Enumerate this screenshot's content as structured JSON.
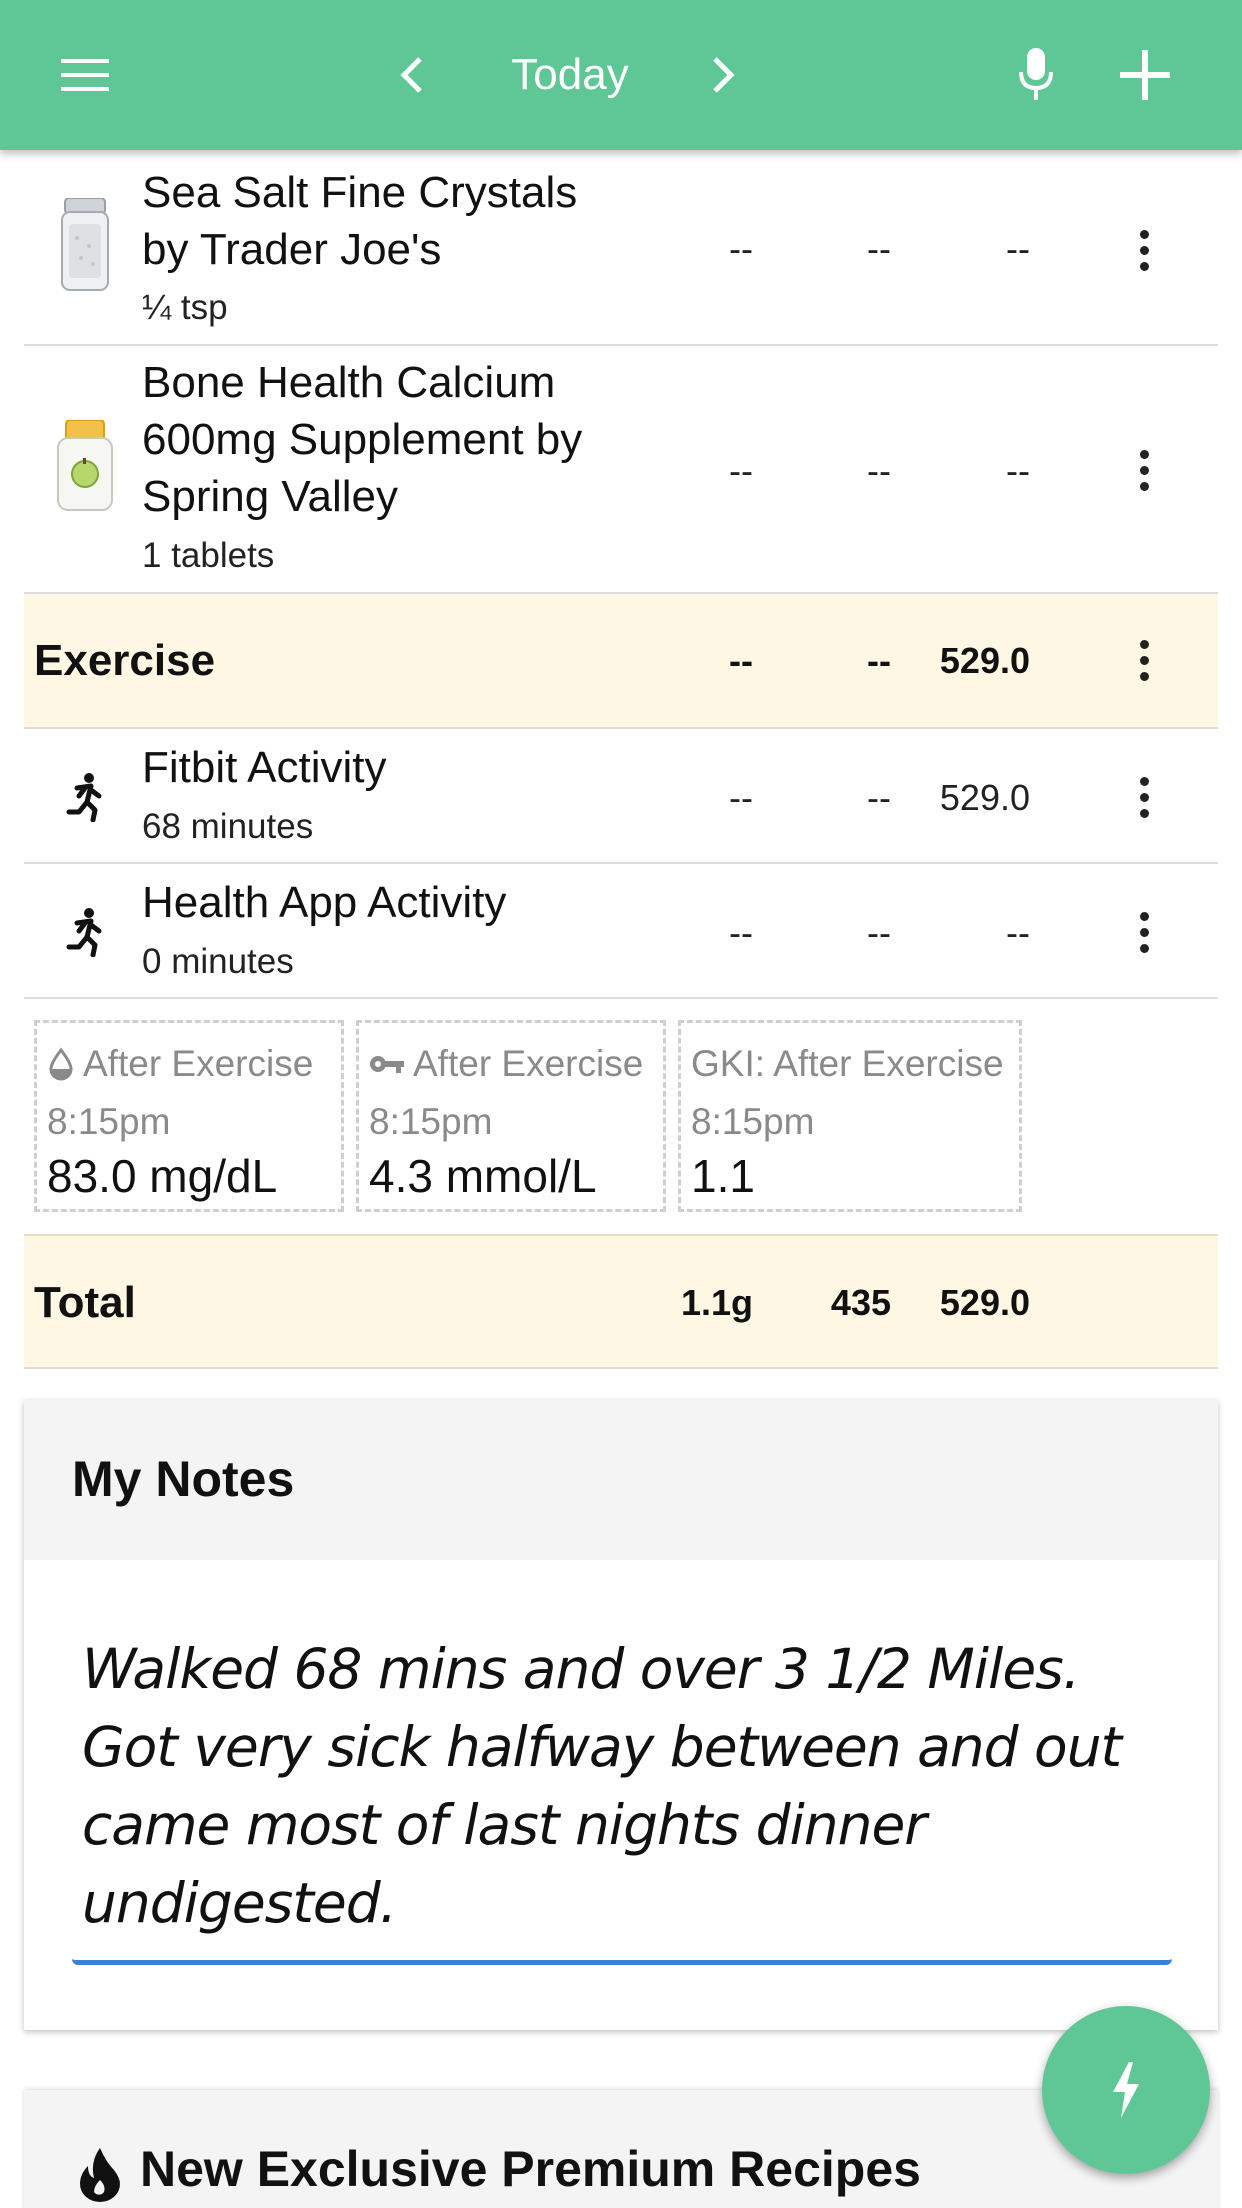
{
  "header": {
    "title": "Today",
    "icons": [
      "menu-icon",
      "chevron-left-icon",
      "chevron-right-icon",
      "microphone-icon",
      "plus-icon"
    ],
    "color": "#5fc795"
  },
  "log": {
    "items": [
      {
        "title_lines": [
          "Sea Salt Fine Crystals",
          "by Trader Joe's"
        ],
        "subtitle": "¼ tsp",
        "c1": "--",
        "c2": "--",
        "c3": "--"
      },
      {
        "title_lines": [
          "Bone Health Calcium",
          "600mg Supplement by",
          "Spring Valley"
        ],
        "subtitle": "1 tablets",
        "c1": "--",
        "c2": "--",
        "c3": "--"
      }
    ],
    "exercise_section": {
      "title": "Exercise",
      "c1": "--",
      "c2": "--",
      "c3": "529.0"
    },
    "exercise_items": [
      {
        "title": "Fitbit Activity",
        "subtitle": "68 minutes",
        "c1": "--",
        "c2": "--",
        "c3": "529.0"
      },
      {
        "title": "Health App Activity",
        "subtitle": "0 minutes",
        "c1": "--",
        "c2": "--",
        "c3": "--"
      }
    ]
  },
  "measurements": [
    {
      "label": "After Exercise",
      "time": "8:15pm",
      "value": "83.0 mg/dL",
      "icon": "drop-icon"
    },
    {
      "label": "After Exercise",
      "time": "8:15pm",
      "value": "4.3 mmol/L",
      "icon": "key-icon"
    },
    {
      "label": "GKI: After Exercise",
      "time": "8:15pm",
      "value": "1.1"
    }
  ],
  "total": {
    "label": "Total",
    "c1": "1.1g",
    "c2": "435",
    "c3": "529.0"
  },
  "notes": {
    "title": "My Notes",
    "text": "Walked 68 mins and over 3 1/2 Miles. Got very sick halfway between and out came most of last nights dinner undigested."
  },
  "premium": {
    "title": "New Exclusive Premium Recipes",
    "icon": "flame-icon"
  },
  "fab": {
    "icon": "lightning-icon"
  }
}
